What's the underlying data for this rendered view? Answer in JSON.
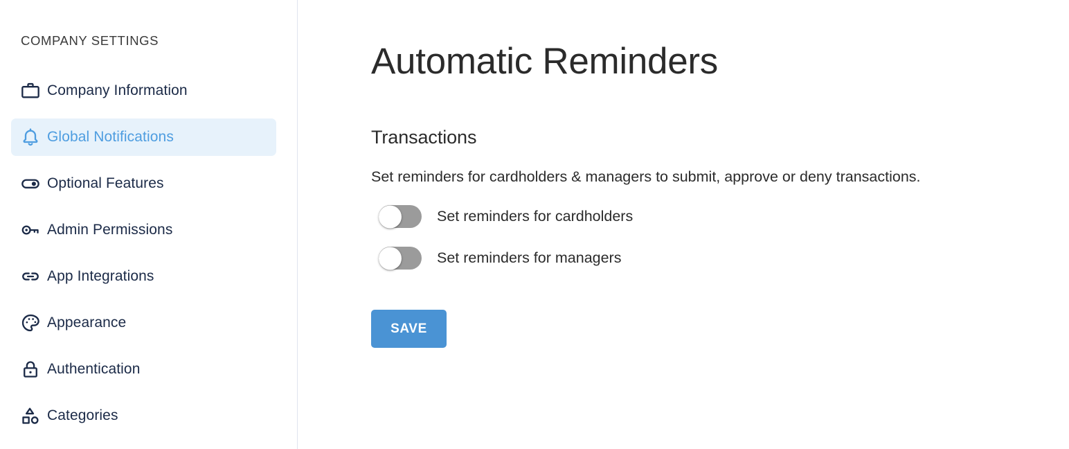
{
  "sidebar": {
    "title": "COMPANY SETTINGS",
    "items": [
      {
        "label": "Company Information",
        "icon": "briefcase-icon",
        "active": false
      },
      {
        "label": "Global Notifications",
        "icon": "bell-icon",
        "active": true
      },
      {
        "label": "Optional Features",
        "icon": "toggle-icon",
        "active": false
      },
      {
        "label": "Admin Permissions",
        "icon": "key-icon",
        "active": false
      },
      {
        "label": "App Integrations",
        "icon": "link-icon",
        "active": false
      },
      {
        "label": "Appearance",
        "icon": "palette-icon",
        "active": false
      },
      {
        "label": "Authentication",
        "icon": "lock-icon",
        "active": false
      },
      {
        "label": "Categories",
        "icon": "shapes-icon",
        "active": false
      }
    ]
  },
  "main": {
    "page_title": "Automatic Reminders",
    "section": {
      "title": "Transactions",
      "description": "Set reminders for cardholders & managers to submit, approve or deny transactions.",
      "toggles": [
        {
          "label": "Set reminders for cardholders",
          "state": "off"
        },
        {
          "label": "Set reminders for managers",
          "state": "off"
        }
      ]
    },
    "save_label": "SAVE"
  },
  "colors": {
    "accent_blue": "#4e9de0",
    "save_button_blue": "#4a93d4",
    "active_item_background": "#e7f2fb",
    "icon_navy": "#1b2a47",
    "toggle_off_track": "#9b9b9b",
    "sidebar_border": "#dfe4ee",
    "body_text": "#2b2b2b"
  }
}
